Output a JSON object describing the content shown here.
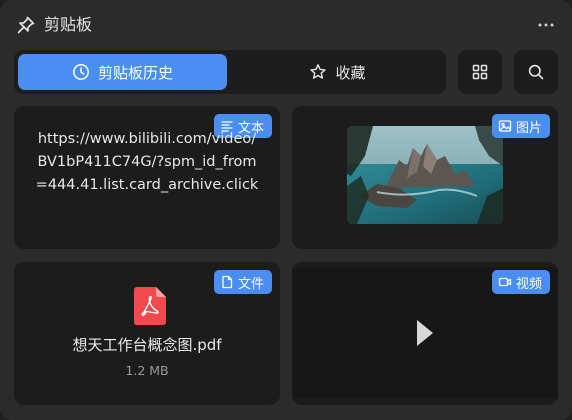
{
  "header": {
    "title": "剪贴板",
    "icons": {
      "pin": "pin-icon",
      "more": "more-horizontal-icon"
    }
  },
  "tabs": [
    {
      "label": "剪贴板历史",
      "icon": "clock-icon",
      "active": true
    },
    {
      "label": "收藏",
      "icon": "star-icon",
      "active": false
    }
  ],
  "toolbar": {
    "grid_icon": "grid-icon",
    "search_icon": "search-icon"
  },
  "items": {
    "text": {
      "badge": "文本",
      "content": "https://www.bilibili.com/video/BV1bP411C74G/?spm_id_from=444.41.list.card_archive.click"
    },
    "image": {
      "badge": "图片"
    },
    "file": {
      "badge": "文件",
      "name": "想天工作台概念图.pdf",
      "size": "1.2 MB"
    },
    "video": {
      "badge": "视频"
    }
  },
  "colors": {
    "accent": "#4a8ef2",
    "background": "#2b2b2b",
    "card": "#1c1c1c",
    "pdf_red": "#f0494e"
  }
}
